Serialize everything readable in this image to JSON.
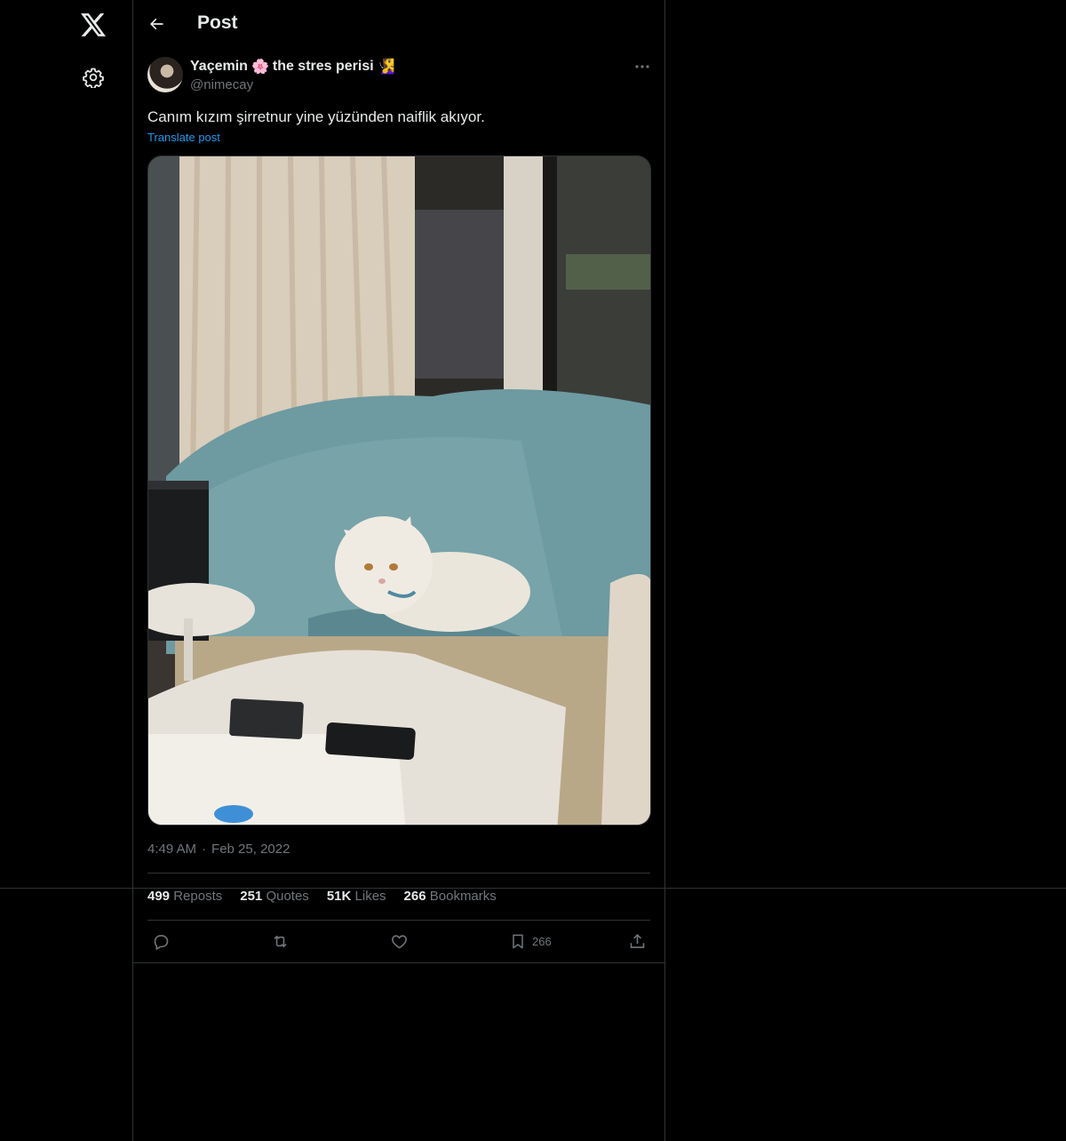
{
  "header": {
    "title": "Post"
  },
  "author": {
    "display_name": "Yaçemin",
    "emoji1": "🌸",
    "name_suffix": "the stres perisi",
    "emoji2": "🧏‍♀️",
    "handle": "@nimecay"
  },
  "post": {
    "text": "Canım kızım şirretnur yine yüzünden naiflik akıyor.",
    "translate_label": "Translate post",
    "time": "4:49 AM",
    "dot": "·",
    "date": "Feb 25, 2022"
  },
  "stats": {
    "reposts_count": "499",
    "reposts_label": "Reposts",
    "quotes_count": "251",
    "quotes_label": "Quotes",
    "likes_count": "51K",
    "likes_label": "Likes",
    "bookmarks_count": "266",
    "bookmarks_label": "Bookmarks"
  },
  "actions": {
    "bookmark_count": "266"
  },
  "icons": {
    "logo": "x-logo-icon",
    "settings": "gear-icon",
    "back": "arrow-left-icon",
    "more": "more-horizontal-icon",
    "reply": "reply-icon",
    "repost": "repost-icon",
    "like": "heart-icon",
    "bookmark": "bookmark-icon",
    "share": "share-icon"
  },
  "colors": {
    "background": "#000000",
    "text": "#e7e9ea",
    "secondary": "#71767b",
    "link": "#1d9bf0",
    "border": "#2f3336"
  }
}
